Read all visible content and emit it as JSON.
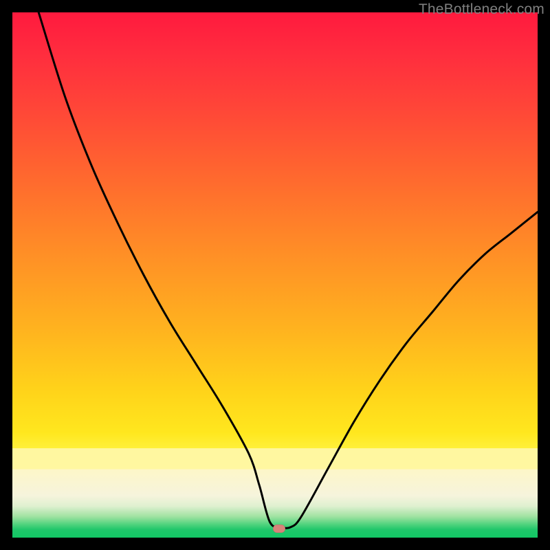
{
  "watermark": "TheBottleneck.com",
  "marker": {
    "x_frac": 0.508,
    "y_frac": 0.983,
    "color": "#d7847a"
  },
  "chart_data": {
    "type": "line",
    "title": "",
    "xlabel": "",
    "ylabel": "",
    "xlim": [
      0,
      100
    ],
    "ylim": [
      0,
      100
    ],
    "grid": false,
    "series": [
      {
        "name": "bottleneck-curve",
        "color": "#000000",
        "x": [
          5,
          10,
          15,
          20,
          25,
          30,
          35,
          40,
          45,
          47,
          49,
          51,
          53,
          55,
          60,
          65,
          70,
          75,
          80,
          85,
          90,
          95,
          100
        ],
        "y": [
          100,
          84,
          71,
          60,
          50,
          41,
          33,
          25,
          16,
          10,
          3,
          2,
          2,
          4,
          13,
          22,
          30,
          37,
          43,
          49,
          54,
          58,
          62
        ]
      }
    ],
    "annotations": [
      {
        "type": "marker",
        "x": 50.8,
        "y": 1.7,
        "label": "optimal-point"
      }
    ],
    "background_gradient": {
      "stops": [
        {
          "pos": 0.0,
          "color": "#ff1a3e"
        },
        {
          "pos": 0.32,
          "color": "#ff6a2e"
        },
        {
          "pos": 0.6,
          "color": "#ffb21f"
        },
        {
          "pos": 0.83,
          "color": "#fff03a"
        },
        {
          "pos": 0.94,
          "color": "#dff0d0"
        },
        {
          "pos": 1.0,
          "color": "#12c765"
        }
      ]
    }
  }
}
